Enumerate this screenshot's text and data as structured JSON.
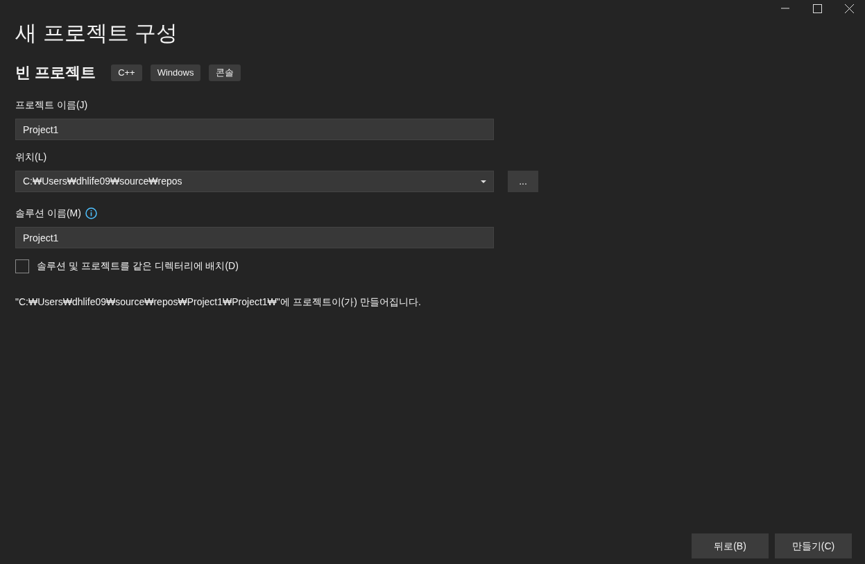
{
  "title": "새 프로젝트 구성",
  "template": {
    "name": "빈 프로젝트",
    "tags": [
      "C++",
      "Windows",
      "콘솔"
    ]
  },
  "project_name": {
    "label": "프로젝트 이름(J)",
    "value": "Project1"
  },
  "location": {
    "label": "위치(L)",
    "value": "C:₩Users₩dhlife09₩source₩repos",
    "browse": "..."
  },
  "solution_name": {
    "label": "솔루션 이름(M)",
    "value": "Project1"
  },
  "same_directory": {
    "label": "솔루션 및 프로젝트를 같은 디렉터리에 배치(D)",
    "checked": false
  },
  "note": "\"C:₩Users₩dhlife09₩source₩repos₩Project1₩Project1₩\"에 프로젝트이(가) 만들어집니다.",
  "buttons": [
    "뒤로(B)",
    "만들기(C)"
  ]
}
